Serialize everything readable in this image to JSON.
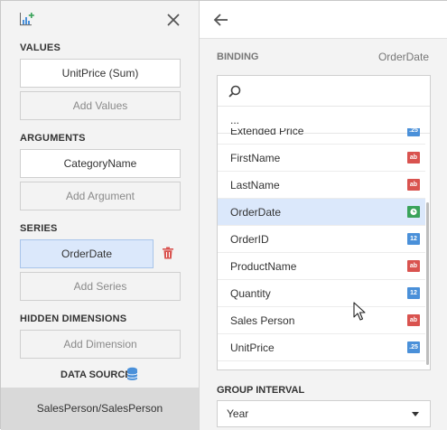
{
  "colors": {
    "accent_green": "#3aa35a",
    "selection": "#dbe8fb",
    "trash_red": "#d9534f",
    "badge_text": "#d9534f",
    "badge_numeric": "#4a90d9"
  },
  "left": {
    "values_label": "VALUES",
    "values_item": "UnitPrice (Sum)",
    "add_values": "Add Values",
    "arguments_label": "ARGUMENTS",
    "arguments_item": "CategoryName",
    "add_argument": "Add Argument",
    "series_label": "SERIES",
    "series_item": "OrderDate",
    "add_series": "Add Series",
    "hidden_label": "HIDDEN DIMENSIONS",
    "add_dimension": "Add Dimension",
    "data_source_label": "DATA SOURCE",
    "footer_source": "SalesPerson/SalesPerson"
  },
  "right": {
    "binding_label": "BINDING",
    "binding_value": "OrderDate",
    "ellipsis": "...",
    "fields": [
      {
        "name": "Extended Price",
        "type": ".25",
        "kind": "num"
      },
      {
        "name": "FirstName",
        "type": "ab",
        "kind": "ab"
      },
      {
        "name": "LastName",
        "type": "ab",
        "kind": "ab"
      },
      {
        "name": "OrderDate",
        "type": "",
        "kind": "dt",
        "selected": true
      },
      {
        "name": "OrderID",
        "type": "12",
        "kind": "num"
      },
      {
        "name": "ProductName",
        "type": "ab",
        "kind": "ab"
      },
      {
        "name": "Quantity",
        "type": "12",
        "kind": "num"
      },
      {
        "name": "Sales Person",
        "type": "ab",
        "kind": "ab"
      },
      {
        "name": "UnitPrice",
        "type": ".25",
        "kind": "num"
      }
    ],
    "group_interval_label": "GROUP INTERVAL",
    "group_interval_value": "Year"
  }
}
